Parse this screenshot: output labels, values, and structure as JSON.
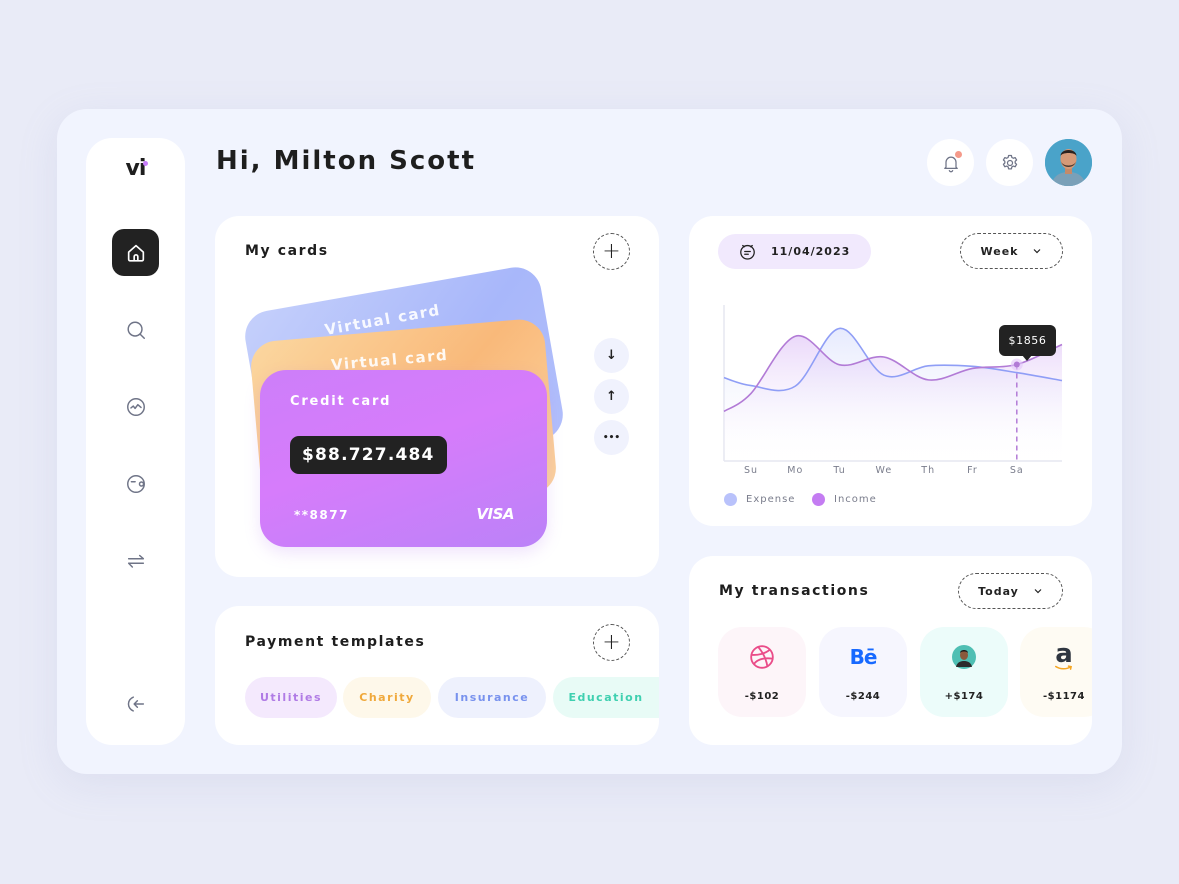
{
  "logo": {
    "text": "vi",
    "accent": "#c77dfa"
  },
  "header": {
    "greeting": "Hi, Milton Scott",
    "notifications_has_unread": true
  },
  "sidebar": {
    "items": [
      {
        "name": "home",
        "icon": "home-icon",
        "active": true
      },
      {
        "name": "search",
        "icon": "search-icon",
        "active": false
      },
      {
        "name": "activity",
        "icon": "activity-icon",
        "active": false
      },
      {
        "name": "wallet",
        "icon": "wallet-icon",
        "active": false
      },
      {
        "name": "transfer",
        "icon": "transfer-icon",
        "active": false
      }
    ],
    "logout_icon": "logout-icon"
  },
  "cards": {
    "title": "My cards",
    "add_label": "+",
    "back_cards": [
      {
        "label": "Virtual card",
        "color": "#a8b7fa"
      },
      {
        "label": "Virtual card",
        "color": "#f9b97a"
      }
    ],
    "front_card": {
      "type": "Credit card",
      "balance": "$88.727.484",
      "number": "**8877",
      "brand": "VISA"
    },
    "actions": [
      {
        "name": "move-down",
        "glyph": "↓"
      },
      {
        "name": "move-up",
        "glyph": "↑"
      },
      {
        "name": "more",
        "glyph": "•••"
      }
    ]
  },
  "templates": {
    "title": "Payment templates",
    "add_label": "+",
    "items": [
      {
        "label": "Utilities",
        "color": "#b07be5",
        "bg": "#f4e9fd"
      },
      {
        "label": "Charity",
        "color": "#f0a93c",
        "bg": "#fef8ea"
      },
      {
        "label": "Insurance",
        "color": "#7892ee",
        "bg": "#eef1fd"
      },
      {
        "label": "Education",
        "color": "#3fd0b0",
        "bg": "#e8fbf6"
      }
    ]
  },
  "stats": {
    "date": "11/04/2023",
    "period": "Week",
    "tooltip": "$1856",
    "legend": [
      {
        "label": "Expense",
        "color": "#b9c2fb"
      },
      {
        "label": "Income",
        "color": "#c47cf2"
      }
    ]
  },
  "chart_data": {
    "type": "line",
    "categories": [
      "Su",
      "Mo",
      "Tu",
      "We",
      "Th",
      "Fr",
      "Sa"
    ],
    "series": [
      {
        "name": "Expense",
        "color": "#8f9ef6",
        "values": [
          1450,
          1440,
          2550,
          1650,
          1830,
          1820,
          1700
        ]
      },
      {
        "name": "Income",
        "color": "#b27bd6",
        "values": [
          1300,
          2400,
          1850,
          2000,
          1560,
          1780,
          1856
        ]
      }
    ],
    "highlight": {
      "category": "Sa",
      "series": "Income",
      "value": 1856
    },
    "ylim": [
      0,
      3000
    ],
    "grid": false,
    "legend": "bottom-left"
  },
  "transactions": {
    "title": "My transactions",
    "period": "Today",
    "items": [
      {
        "merchant": "Dribbble",
        "icon": "dribbble-icon",
        "amount": "-$102",
        "bg": "#fdf5f9"
      },
      {
        "merchant": "Behance",
        "icon": "behance-icon",
        "amount": "-$244",
        "bg": "#f6f6fe",
        "logo_text": "Bē"
      },
      {
        "merchant": "Person",
        "icon": "person-avatar-icon",
        "amount": "+$174",
        "bg": "#ecfcfa"
      },
      {
        "merchant": "Amazon",
        "icon": "amazon-icon",
        "amount": "-$1174",
        "bg": "#fefbf3",
        "logo_text": "a"
      }
    ]
  }
}
